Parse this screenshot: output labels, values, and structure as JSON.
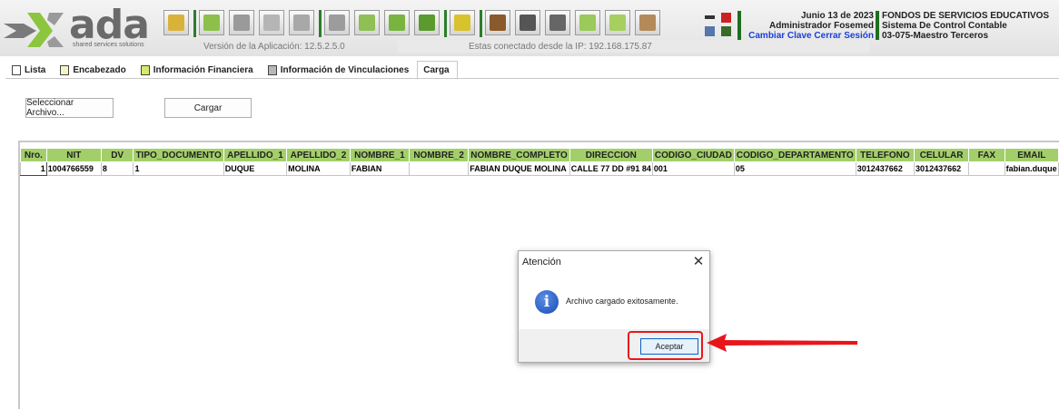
{
  "app": {
    "logo_text": "ada",
    "logo_sub": "shared services solutions",
    "version": "Versión de la Aplicación: 12.5.2.5.0",
    "connection": "Estas conectado desde la IP: 192.168.175.87"
  },
  "user": {
    "date": "Junio 13 de 2023",
    "name": "Administrador Fosemed",
    "change_password": "Cambiar Clave",
    "logout": "Cerrar Sesión"
  },
  "org": {
    "name": "FONDOS DE SERVICIOS EDUCATIVOS",
    "system": "Sistema De Control Contable",
    "module": "03-075-Maestro Terceros"
  },
  "toolbar": {
    "icons": [
      "folder-open-icon",
      "add-icon",
      "save-icon",
      "delete-icon",
      "undo-icon",
      "print-icon",
      "search-icon",
      "image-icon",
      "export-icon",
      "lock-icon",
      "money-icon",
      "camera-icon",
      "calculator-icon",
      "cart-icon",
      "edit-icon",
      "users-icon"
    ]
  },
  "tabs": [
    {
      "label": "Lista",
      "icon": "list-icon"
    },
    {
      "label": "Encabezado",
      "icon": "document-icon"
    },
    {
      "label": "Información Financiera",
      "icon": "finance-icon"
    },
    {
      "label": "Información de Vinculaciones",
      "icon": "links-icon"
    },
    {
      "label": "Carga",
      "icon": ""
    }
  ],
  "actions": {
    "select_file": "Seleccionar Archivo...",
    "upload": "Cargar"
  },
  "grid": {
    "columns": [
      "Nro.",
      "NIT",
      "DV",
      "TIPO_DOCUMENTO",
      "APELLIDO_1",
      "APELLIDO_2",
      "NOMBRE_1",
      "NOMBRE_2",
      "NOMBRE_COMPLETO",
      "DIRECCION",
      "CODIGO_CIUDAD",
      "CODIGO_DEPARTAMENTO",
      "TELEFONO",
      "CELULAR",
      "FAX",
      "EMAIL"
    ],
    "rows": [
      [
        "1",
        "1004766559",
        "8",
        "1",
        "DUQUE",
        "MOLINA",
        "FABIAN",
        "",
        "FABIAN DUQUE MOLINA",
        "CALLE 77 DD #91 84",
        "001",
        "05",
        "3012437662",
        "3012437662",
        "",
        "fabian.duque"
      ]
    ]
  },
  "dialog": {
    "title": "Atención",
    "message": "Archivo cargado exitosamente.",
    "ok": "Aceptar"
  },
  "colors": {
    "header_green": "#a3cf6a",
    "annotation_red": "#e8161b",
    "link_blue": "#1a3fd6"
  }
}
